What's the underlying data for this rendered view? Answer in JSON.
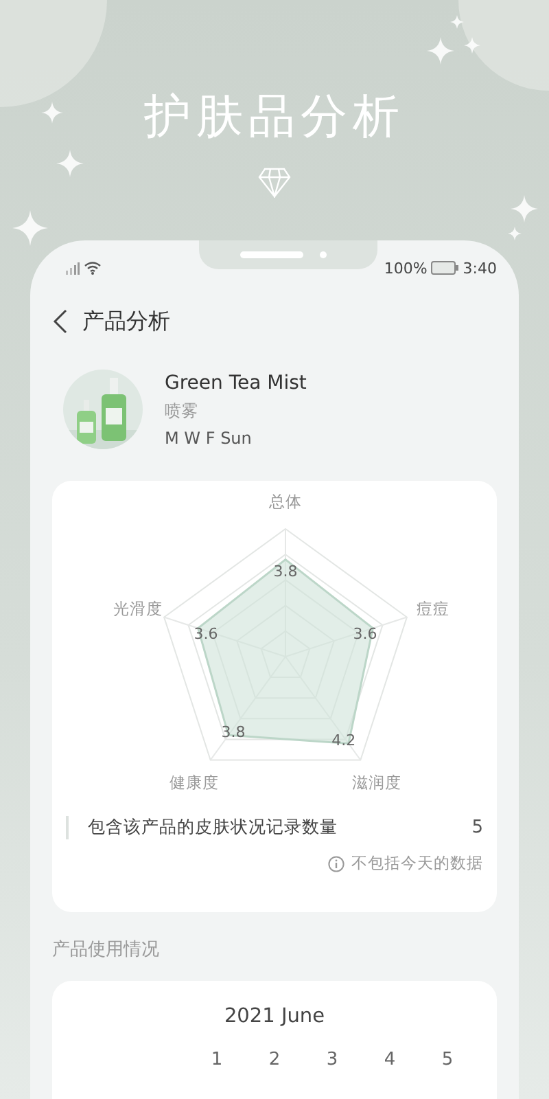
{
  "banner": {
    "title": "护肤品分析"
  },
  "status_bar": {
    "battery": "100%",
    "time": "3:40"
  },
  "header": {
    "title": "产品分析"
  },
  "product": {
    "name": "Green Tea Mist",
    "type": "喷雾",
    "schedule": "M W F Sun"
  },
  "radar": {
    "axes": [
      {
        "label": "总体",
        "value": "3.8"
      },
      {
        "label": "光滑度",
        "value": "3.6"
      },
      {
        "label": "痘痘",
        "value": "3.6"
      },
      {
        "label": "健康度",
        "value": "3.8"
      },
      {
        "label": "滋润度",
        "value": "4.2"
      }
    ]
  },
  "record_count": {
    "label": "包含该产品的皮肤状况记录数量",
    "value": "5"
  },
  "note": "不包括今天的数据",
  "usage": {
    "title": "产品使用情况",
    "month": "2021 June",
    "days": [
      "1",
      "2",
      "3",
      "4",
      "5"
    ]
  }
}
